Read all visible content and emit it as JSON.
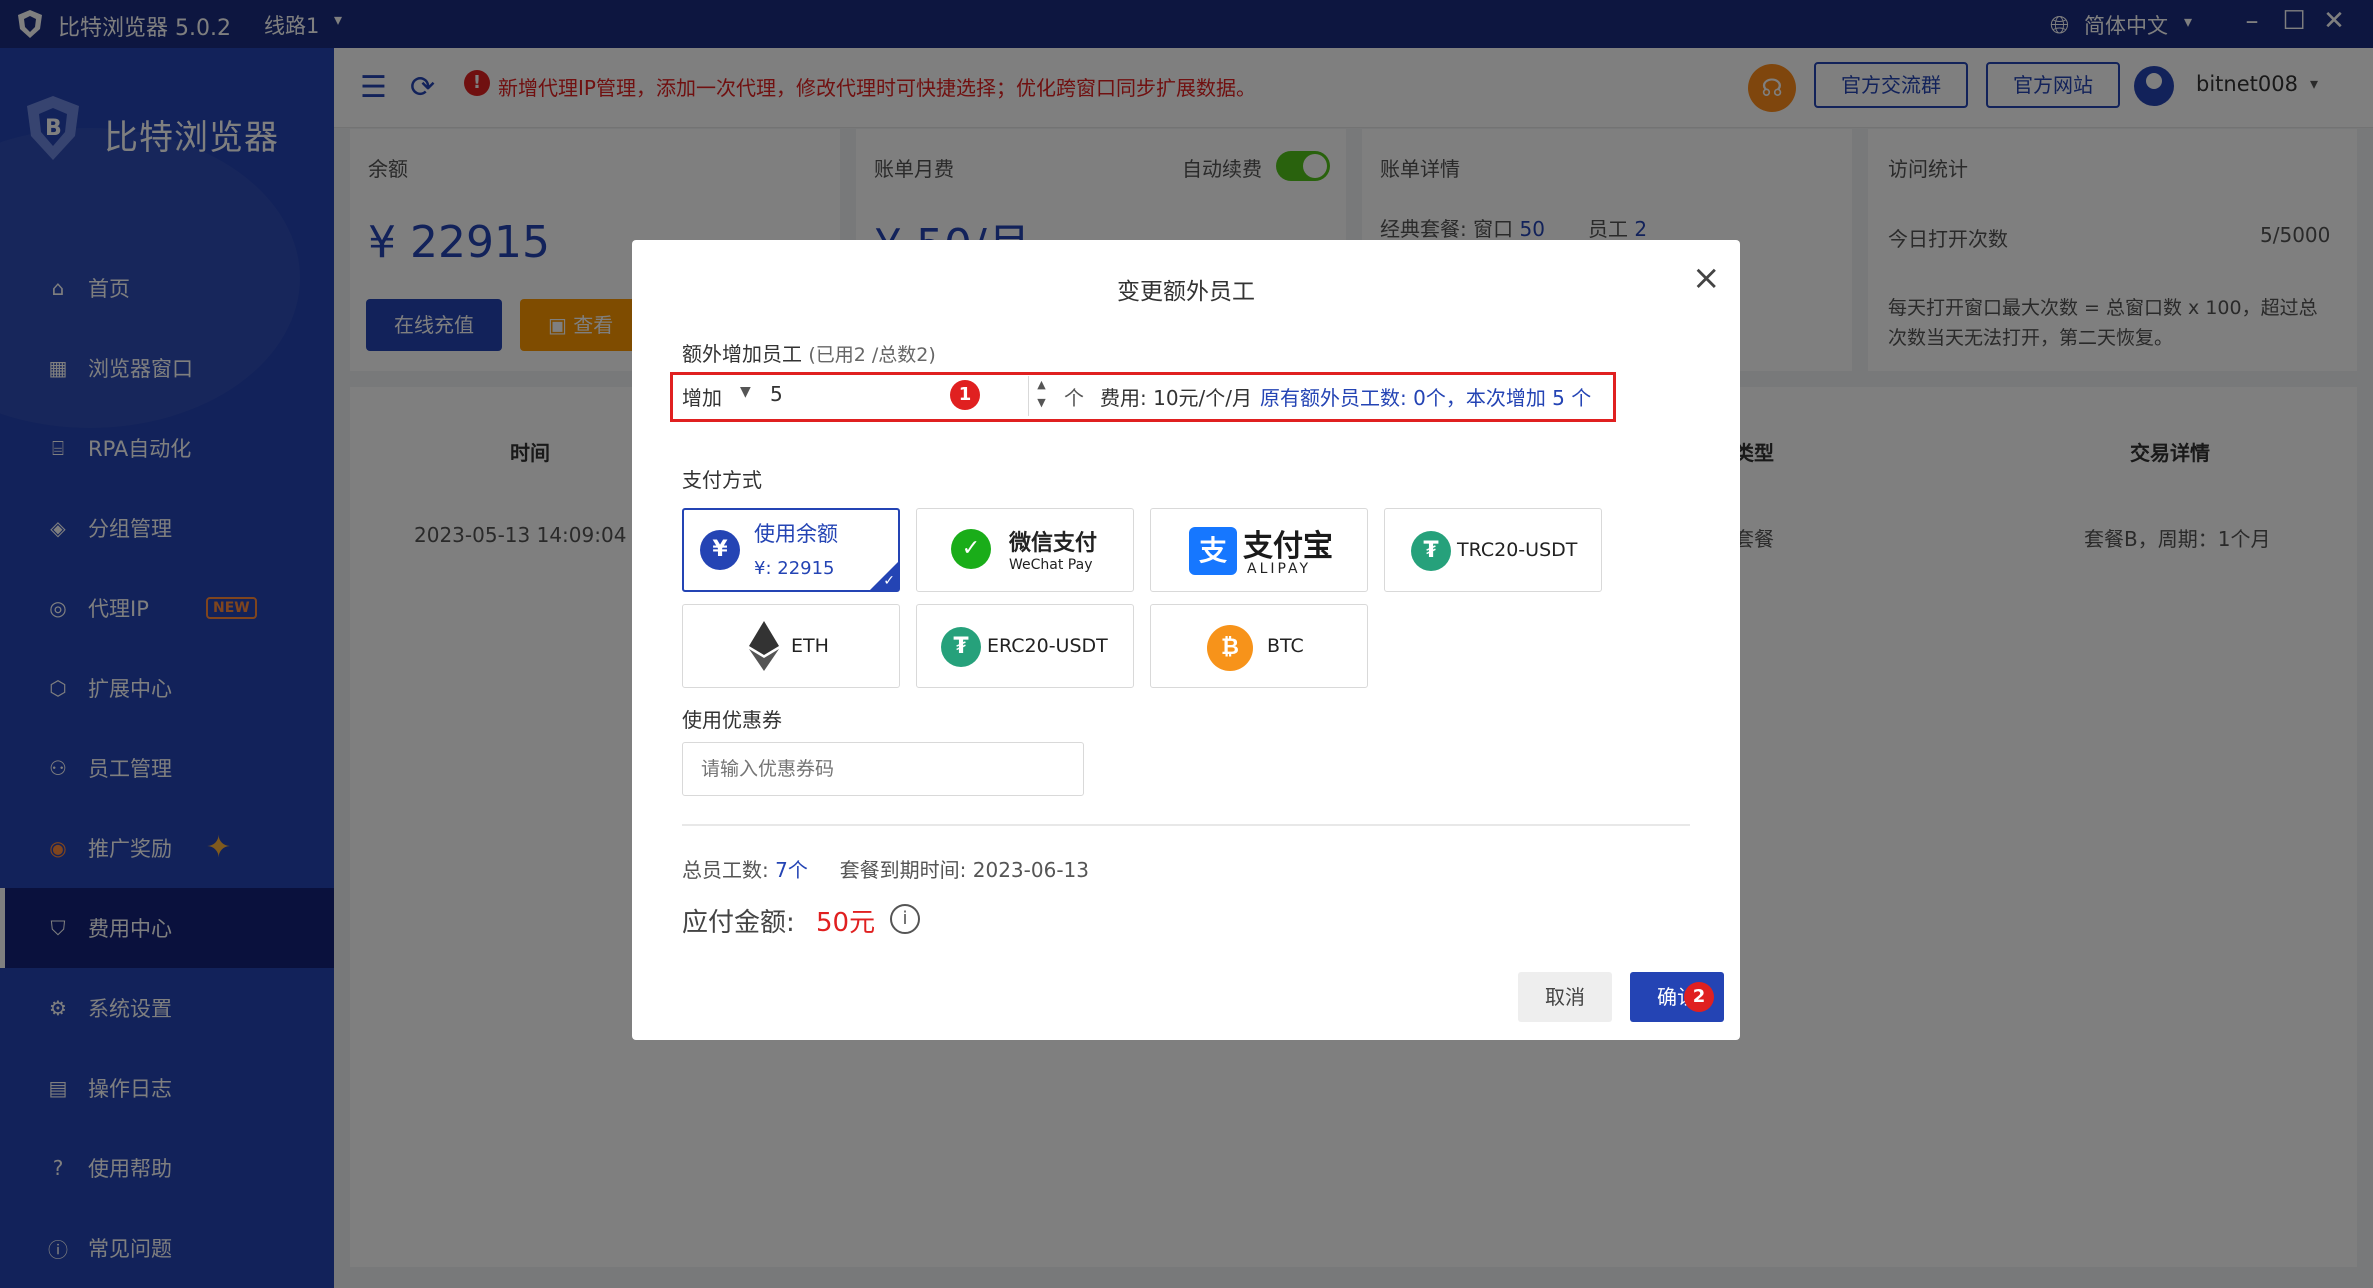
{
  "titlebar": {
    "app_title": "比特浏览器 5.0.2",
    "line": "线路1",
    "language": "简体中文"
  },
  "sidebar": {
    "brand": "比特浏览器",
    "items": [
      {
        "label": "首页",
        "icon": "home-icon"
      },
      {
        "label": "浏览器窗口",
        "icon": "grid-icon"
      },
      {
        "label": "RPA自动化",
        "icon": "robot-icon"
      },
      {
        "label": "分组管理",
        "icon": "layers-icon"
      },
      {
        "label": "代理IP",
        "icon": "location-pin-icon",
        "badge": "NEW"
      },
      {
        "label": "扩展中心",
        "icon": "cube-icon"
      },
      {
        "label": "员工管理",
        "icon": "users-icon"
      },
      {
        "label": "推广奖励",
        "icon": "coin-icon"
      },
      {
        "label": "费用中心",
        "icon": "shield-icon",
        "active": true
      },
      {
        "label": "系统设置",
        "icon": "gear-icon"
      },
      {
        "label": "操作日志",
        "icon": "log-icon"
      },
      {
        "label": "使用帮助",
        "icon": "help-icon"
      },
      {
        "label": "常见问题",
        "icon": "info-icon"
      }
    ]
  },
  "header": {
    "notice": "新增代理IP管理，添加一次代理，修改代理时可快捷选择；优化跨窗口同步扩展数据。",
    "btn_group": "官方交流群",
    "btn_site": "官方网站",
    "username": "bitnet008"
  },
  "cards": {
    "balance_label": "余额",
    "balance_value": "¥ 22915",
    "recharge_label": "在线充值",
    "view_label": "查看",
    "monthly_label": "账单月费",
    "auto_renew_label": "自动续费",
    "monthly_value": "¥ 50/月",
    "bill_detail_label": "账单详情",
    "plan_text": "经典套餐: 窗口",
    "plan_windows": "50",
    "staff_text": "员工",
    "staff_count": "2",
    "visit_label": "访问统计",
    "today_opens_label": "今日打开次数",
    "today_opens_value": "5/5000",
    "visit_note_1": "每天打开窗口最大次数 = 总窗口数 x 100，超过总",
    "visit_note_2": "次数当天无法打开，第二天恢复。"
  },
  "table": {
    "headers": [
      "时间",
      "类型",
      "交易详情"
    ],
    "row": {
      "time": "2023-05-13 14:09:04",
      "type": "套餐",
      "detail": "套餐B，周期：1个月"
    }
  },
  "modal": {
    "title": "变更额外员工",
    "extra_label": "额外增加员工",
    "extra_sub": "(已用2 /总数2)",
    "operation": "增加",
    "quantity": "5",
    "marker1": "1",
    "unit": "个",
    "fee": "费用: 10元/个/月",
    "fee_detail": "原有额外员工数: 0个，本次增加 5 个",
    "pay_method_label": "支付方式",
    "pay_options": [
      {
        "name": "使用余额",
        "sub": "¥: 22915"
      },
      {
        "name": "微信支付",
        "sub": "WeChat Pay"
      },
      {
        "name": "支付宝",
        "sub": "ALIPAY"
      },
      {
        "name": "TRC20-USDT"
      },
      {
        "name": "ETH"
      },
      {
        "name": "ERC20-USDT"
      },
      {
        "name": "BTC"
      }
    ],
    "coupon_label": "使用优惠券",
    "coupon_placeholder": "请输入优惠券码",
    "total_staff_label": "总员工数:",
    "total_staff_value": "7个",
    "expire_label": "套餐到期时间:",
    "expire_value": "2023-06-13",
    "pay_amount_label": "应付金额:",
    "pay_amount_value": "50元",
    "cancel": "取消",
    "confirm": "确认",
    "marker2": "2"
  },
  "colors": {
    "primary": "#2444b4",
    "sidebar_bg": "#2444b4",
    "titlebar_bg": "#1b2d80",
    "danger": "#e02020",
    "toggle_on": "#52c41a",
    "orange": "#ff9800"
  }
}
